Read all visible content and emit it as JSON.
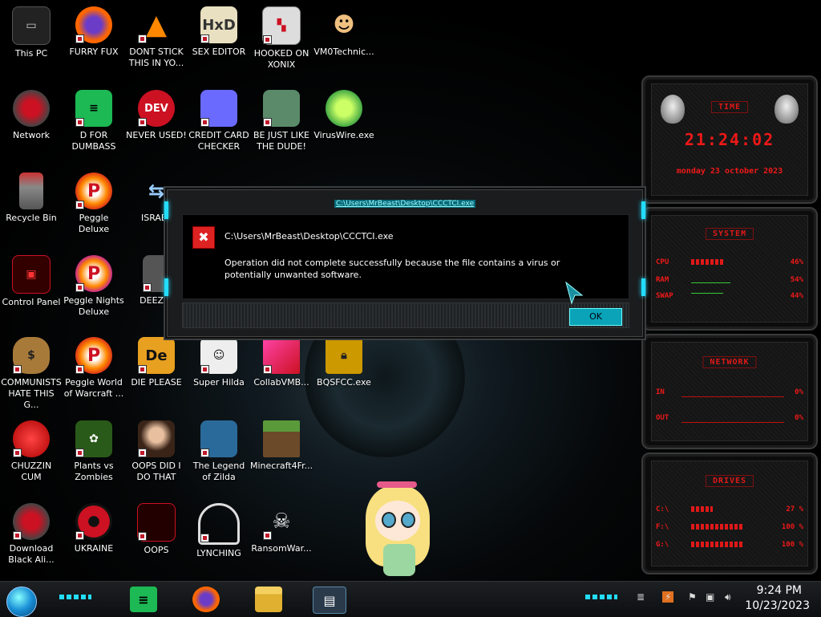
{
  "desktop": {
    "icons": [
      {
        "label": "This PC"
      },
      {
        "label": "FURRY FUX"
      },
      {
        "label": "DONT STICK THIS IN YO..."
      },
      {
        "label": "SEX EDITOR"
      },
      {
        "label": "HOOKED ON XONIX"
      },
      {
        "label": "VM0Technic..."
      },
      {
        "label": "Network"
      },
      {
        "label": "D FOR DUMBASS"
      },
      {
        "label": "NEVER USED!"
      },
      {
        "label": "CREDIT CARD CHECKER"
      },
      {
        "label": "BE JUST LIKE THE DUDE!"
      },
      {
        "label": "VirusWire.exe"
      },
      {
        "label": "Recycle Bin"
      },
      {
        "label": "Peggle Deluxe"
      },
      {
        "label": "ISRAEL"
      },
      {
        "label": "Control Panel"
      },
      {
        "label": "Peggle Nights Deluxe"
      },
      {
        "label": "DEEZ N"
      },
      {
        "label": "COMMUNISTS HATE THIS G..."
      },
      {
        "label": "Peggle World of Warcraft ..."
      },
      {
        "label": "DIE PLEASE"
      },
      {
        "label": "Super Hilda"
      },
      {
        "label": "CollabVMB..."
      },
      {
        "label": "BQSFCC.exe"
      },
      {
        "label": "CHUZZIN CUM"
      },
      {
        "label": "Plants vs Zombies"
      },
      {
        "label": "OOPS DID I DO THAT"
      },
      {
        "label": "The Legend of Zilda"
      },
      {
        "label": "Minecraft4Fr..."
      },
      {
        "label": "Download Black Ali..."
      },
      {
        "label": "UKRAINE"
      },
      {
        "label": "OOPS"
      },
      {
        "label": "LYNCHING"
      },
      {
        "label": "RansomWar..."
      }
    ]
  },
  "dialog": {
    "title": "C:\\Users\\MrBeast\\Desktop\\CCCTCI.exe",
    "error_glyph": "✖",
    "path": "C:\\Users\\MrBeast\\Desktop\\CCCTCI.exe",
    "message": "Operation did not complete successfully because the file contains a virus or potentially unwanted software.",
    "ok_label": "OK"
  },
  "widgets": {
    "time": {
      "title": "TIME",
      "clock": "21:24:02",
      "date": "monday 23 october 2023"
    },
    "system": {
      "title": "SYSTEM",
      "rows": [
        {
          "name": "CPU",
          "value": "46%",
          "level": 0.46
        },
        {
          "name": "RAM",
          "value": "54%",
          "level": 0.54
        },
        {
          "name": "SWAP",
          "value": "44%",
          "level": 0.44
        }
      ]
    },
    "network": {
      "title": "NETWORK",
      "rows": [
        {
          "name": "IN",
          "value": "0%"
        },
        {
          "name": "OUT",
          "value": "0%"
        }
      ]
    },
    "drives": {
      "title": "DRIVES",
      "rows": [
        {
          "name": "C:\\",
          "value": "27 %",
          "level": 0.27
        },
        {
          "name": "F:\\",
          "value": "100 %",
          "level": 1.0
        },
        {
          "name": "G:\\",
          "value": "100 %",
          "level": 1.0
        }
      ]
    }
  },
  "taskbar": {
    "time": "9:24 PM",
    "date": "10/23/2023",
    "pinned": [
      "spotify-icon",
      "firefox-icon",
      "file-explorer-icon",
      "active-window-icon"
    ]
  },
  "colors": {
    "accent": "#22ddff",
    "widget_red": "#e01818",
    "ok_button": "#0aa3b8",
    "error_red": "#d22222"
  }
}
